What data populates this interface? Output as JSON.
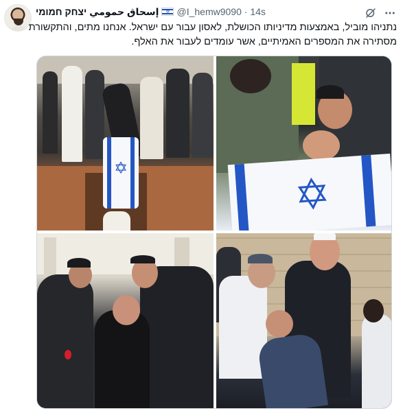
{
  "author": {
    "display_name": "إسحاق حمومي יצחק חמומי",
    "flag_icon": "israel-flag-icon",
    "handle": "@I_hemw9090",
    "separator": "·",
    "time": "14s"
  },
  "actions": {
    "grok_icon": "grok-icon",
    "more_icon": "more-icon"
  },
  "tweet": {
    "text": "נתניהו מוביל, באמצעות מדיניותו הכושלת, לאסון עבור עם ישראל. אנחנו מתים, והתקשורת מסתירה את המספרים האמיתיים, אשר עומדים לעבור את האלף."
  },
  "media": {
    "photo_count": 4
  },
  "colors": {
    "text_primary": "#0f1419",
    "text_secondary": "#536471",
    "border": "#cfd9de",
    "flag_blue": "#2457c5"
  }
}
